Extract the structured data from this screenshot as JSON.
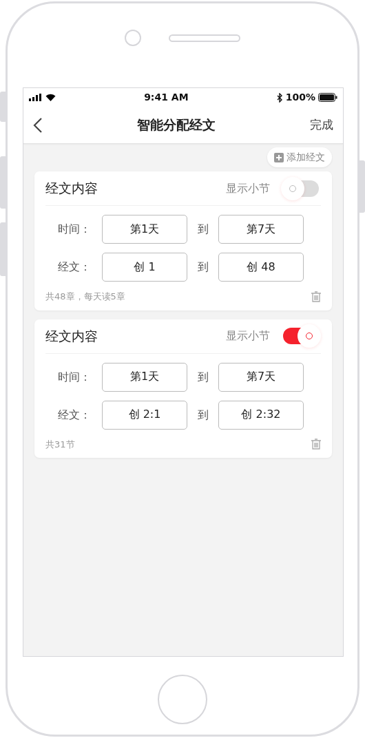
{
  "status_bar": {
    "time": "9:41 AM",
    "battery": "100%"
  },
  "nav": {
    "title": "智能分配经文",
    "action": "完成"
  },
  "add_button": {
    "label": "添加经文"
  },
  "cards": [
    {
      "title": "经文内容",
      "toggle_label": "显示小节",
      "on": false,
      "rows": [
        {
          "label": "时间：",
          "from": "第1天",
          "separator": "到",
          "to": "第7天"
        },
        {
          "label": "经文：",
          "from": "创 1",
          "separator": "到",
          "to": "创 48"
        }
      ],
      "summary": "共48章，每天读5章"
    },
    {
      "title": "经文内容",
      "toggle_label": "显示小节",
      "on": true,
      "rows": [
        {
          "label": "时间：",
          "from": "第1天",
          "separator": "到",
          "to": "第7天"
        },
        {
          "label": "经文：",
          "from": "创 2:1",
          "separator": "到",
          "to": "创 2:32"
        }
      ],
      "summary": "共31节"
    }
  ]
}
